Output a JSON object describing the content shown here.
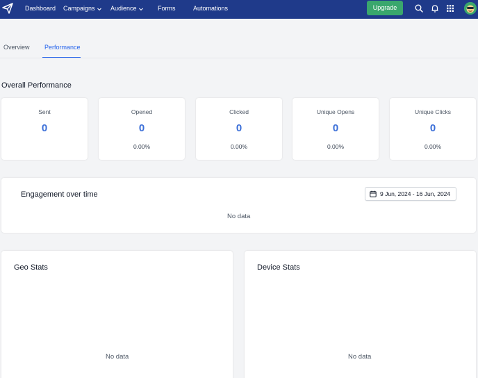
{
  "nav": {
    "items": [
      "Dashboard",
      "Campaigns",
      "Audience",
      "Forms",
      "Automations"
    ],
    "upgrade_label": "Upgrade",
    "colors": {
      "bar": "#1f3a8a",
      "upgrade": "#3aa76d"
    }
  },
  "tabs": [
    {
      "label": "Overview",
      "active": false
    },
    {
      "label": "Performance",
      "active": true
    }
  ],
  "overall": {
    "title": "Overall Performance",
    "stats": [
      {
        "label": "Sent",
        "value": "0",
        "pct": ""
      },
      {
        "label": "Opened",
        "value": "0",
        "pct": "0.00%"
      },
      {
        "label": "Clicked",
        "value": "0",
        "pct": "0.00%"
      },
      {
        "label": "Unique Opens",
        "value": "0",
        "pct": "0.00%"
      },
      {
        "label": "Unique Clicks",
        "value": "0",
        "pct": "0.00%"
      }
    ]
  },
  "engagement": {
    "title": "Engagement over time",
    "date_range": "9 Jun, 2024 - 16 Jun, 2024",
    "empty": "No data"
  },
  "geo": {
    "title": "Geo Stats",
    "empty": "No data"
  },
  "device": {
    "title": "Device Stats",
    "empty": "No data"
  },
  "accent_color": "#3b6fd8"
}
